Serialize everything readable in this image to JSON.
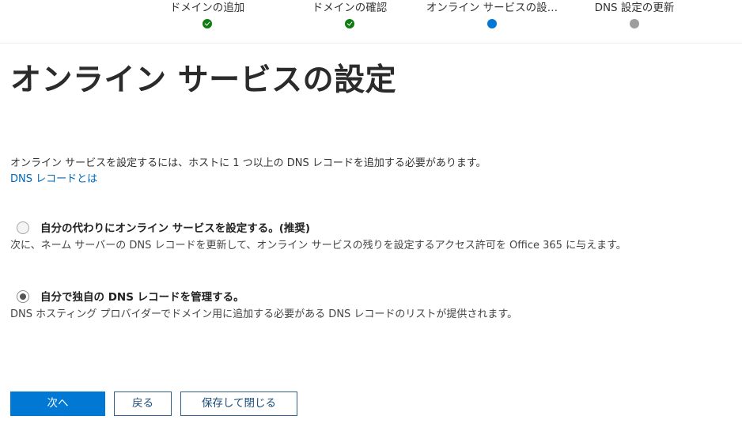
{
  "stepper": {
    "steps": [
      {
        "label": "ドメインの追加",
        "status": "done"
      },
      {
        "label": "ドメインの確認",
        "status": "done"
      },
      {
        "label": "オンライン サービスの設…",
        "status": "current"
      },
      {
        "label": "DNS 設定の更新",
        "status": "pending"
      }
    ]
  },
  "colors": {
    "done": "#107c10",
    "current": "#0078d4",
    "pending": "#9e9e9e",
    "primary": "#0078d4",
    "link": "#0067b8"
  },
  "page": {
    "title": "オンライン サービスの設定",
    "description": "オンライン サービスを設定するには、ホストに 1 つ以上の DNS レコードを追加する必要があります。",
    "learn_link": "DNS レコードとは"
  },
  "options": [
    {
      "label": "自分の代わりにオンライン サービスを設定する。(推奨)",
      "description": "次に、ネーム サーバーの DNS レコードを更新して、オンライン サービスの残りを設定するアクセス許可を Office 365 に与えます。",
      "selected": false
    },
    {
      "label": "自分で独自の DNS レコードを管理する。",
      "description": "DNS ホスティング プロバイダーでドメイン用に追加する必要がある DNS レコードのリストが提供されます。",
      "selected": true
    }
  ],
  "buttons": {
    "next": "次へ",
    "back": "戻る",
    "save_close": "保存して閉じる"
  }
}
